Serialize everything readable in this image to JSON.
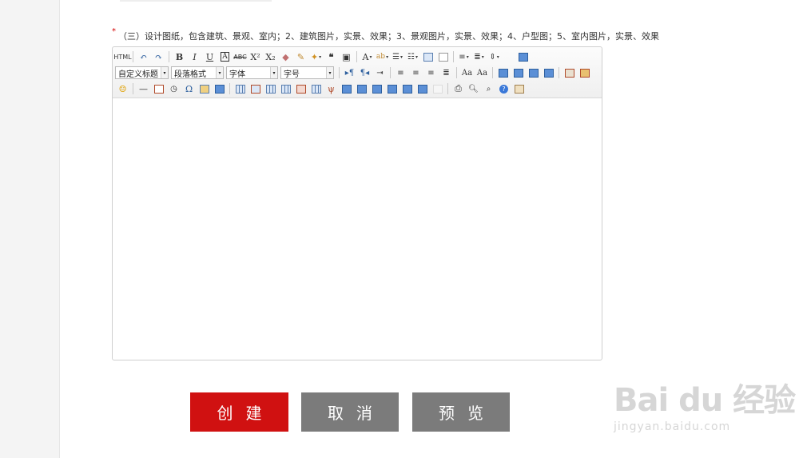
{
  "form": {
    "required_mark": "*",
    "field_label": "（三）设计图纸，包含建筑、景观、室内；2、建筑图片，实景、效果；3、景观图片，实景、效果；4、户型图；5、室内图片，实景、效果"
  },
  "editor": {
    "toolbar": {
      "html_label": "HTML",
      "custom_title_combo": "自定义标题",
      "paragraph_combo": "段落格式",
      "font_combo": "字体",
      "size_combo": "字号"
    },
    "content": ""
  },
  "buttons": {
    "create": "创建",
    "cancel": "取消",
    "preview": "预览"
  },
  "watermark": {
    "main": "Bai du 经验",
    "sub": "jingyan.baidu.com"
  },
  "colors": {
    "create_button": "#d01111",
    "secondary_button": "#7b7b7b",
    "required_mark": "#d40000"
  }
}
